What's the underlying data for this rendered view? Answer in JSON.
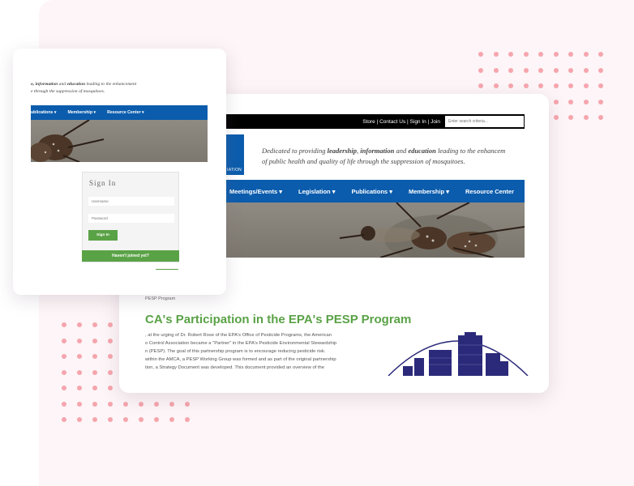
{
  "main": {
    "toplinks": "Store | Contact Us | Sign In | Join",
    "search_placeholder": "Enter search criteria...",
    "logo_fragment": "IATION",
    "tagline_prefix": "Dedicated to providing ",
    "tagline_b1": "leadership",
    "tagline_sep1": ", ",
    "tagline_b2": "information",
    "tagline_mid": " and ",
    "tagline_b3": "education",
    "tagline_rest": " leading to the enhancem",
    "tagline_line2": "of public health and quality of life through the suppression of mosquitoes.",
    "nav": [
      "Meetings/Events",
      "Legislation",
      "Publications",
      "Membership",
      "Resource Center"
    ],
    "breadcrumb": "PESP Program",
    "title": "CA's Participation in the EPA's PESP Program",
    "body_lines": [
      ", at the urging of Dr. Robert Rose of the EPA's Office of Pesticide Programs, the American",
      "o Control Association became a \"Partner\" in the EPA's Pesticide Environmental Stewardship",
      "n (PESP). The goal of this partnership program is to encourage reducing pesticide risk.",
      "within the AMCA, a PESP Working Group was formed and as part of the original partnership",
      "tion, a Strategy Document was developed. This document provided an overview of the"
    ]
  },
  "login_card": {
    "tag_line1_b1": "o, information",
    "tag_line1_mid": " and ",
    "tag_line1_b2": "education",
    "tag_line1_rest": " leading to the enhancement",
    "tag_line2": "e through the suppression of mosquitoes.",
    "nav": [
      "ublications",
      "Membership",
      "Resource Center"
    ],
    "signin_title": "Sign In",
    "username_placeholder": "Username",
    "password_placeholder": "Password",
    "signin_button": "Sign In",
    "join_prompt": "Haven't joined yet?"
  },
  "nav_caret": "▾",
  "colors": {
    "brand_blue": "#0b5cad",
    "brand_green": "#5aa246",
    "dot_pink": "#f6a5ad",
    "skyline_navy": "#2b2a7a"
  }
}
